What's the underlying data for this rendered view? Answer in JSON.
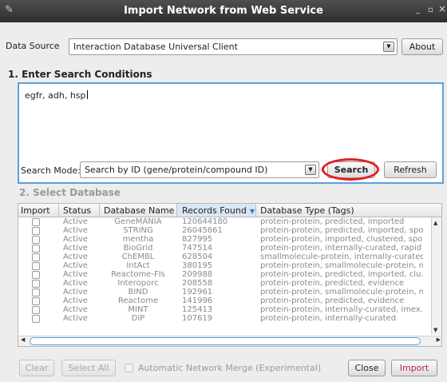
{
  "window": {
    "title": "Import Network from Web Service",
    "minimize": "_",
    "maximize": "▫",
    "close": "×"
  },
  "data_source": {
    "label": "Data Source",
    "value": "Interaction Database Universal Client",
    "about_button": "About"
  },
  "search": {
    "section_title": "1. Enter Search Conditions",
    "query": "egfr, adh, hsp",
    "mode_label": "Search Mode:",
    "mode_value": "Search by ID (gene/protein/compound ID)",
    "search_button": "Search",
    "refresh_button": "Refresh"
  },
  "database": {
    "section_title": "2. Select Database",
    "columns": [
      "Import",
      "Status",
      "Database Name",
      "Records Found",
      "Database Type (Tags)"
    ],
    "sorted_column": "Records Found",
    "rows": [
      {
        "status": "Active",
        "name": "GeneMANIA",
        "records": "120644180",
        "type": "protein-protein, predicted, imported"
      },
      {
        "status": "Active",
        "name": "STRING",
        "records": "26045661",
        "type": "protein-protein, predicted, imported, spo."
      },
      {
        "status": "Active",
        "name": "mentha",
        "records": "827995",
        "type": "protein-protein, imported, clustered, spo."
      },
      {
        "status": "Active",
        "name": "BioGrid",
        "records": "747514",
        "type": "protein-protein, internally-curated, rapid"
      },
      {
        "status": "Active",
        "name": "ChEMBL",
        "records": "628504",
        "type": "smallmolecule-protein, internally-curated."
      },
      {
        "status": "Active",
        "name": "IntAct",
        "records": "380195",
        "type": "protein-protein, smallmolecule-protein, n."
      },
      {
        "status": "Active",
        "name": "Reactome-FIs",
        "records": "209988",
        "type": "protein-protein, predicted, imported, clu.."
      },
      {
        "status": "Active",
        "name": "Interoporc",
        "records": "208558",
        "type": "protein-protein, predicted, evidence"
      },
      {
        "status": "Active",
        "name": "BIND",
        "records": "192961",
        "type": "protein-protein, smallmolecule-protein, n."
      },
      {
        "status": "Active",
        "name": "Reactome",
        "records": "141996",
        "type": "protein-protein, predicted, evidence"
      },
      {
        "status": "Active",
        "name": "MINT",
        "records": "125413",
        "type": "protein-protein, internally-curated, imex.."
      },
      {
        "status": "Active",
        "name": "DIP",
        "records": "107619",
        "type": "protein-protein, internally-curated"
      }
    ]
  },
  "footer": {
    "clear_button": "Clear",
    "select_all_button": "Select All",
    "merge_label": "Automatic Network Merge (Experimental)",
    "close_button": "Close",
    "import_button": "Import"
  },
  "colors": {
    "focus_blue": "#5aa0e0",
    "highlight_red": "#e02020",
    "import_text": "#c0284a"
  }
}
